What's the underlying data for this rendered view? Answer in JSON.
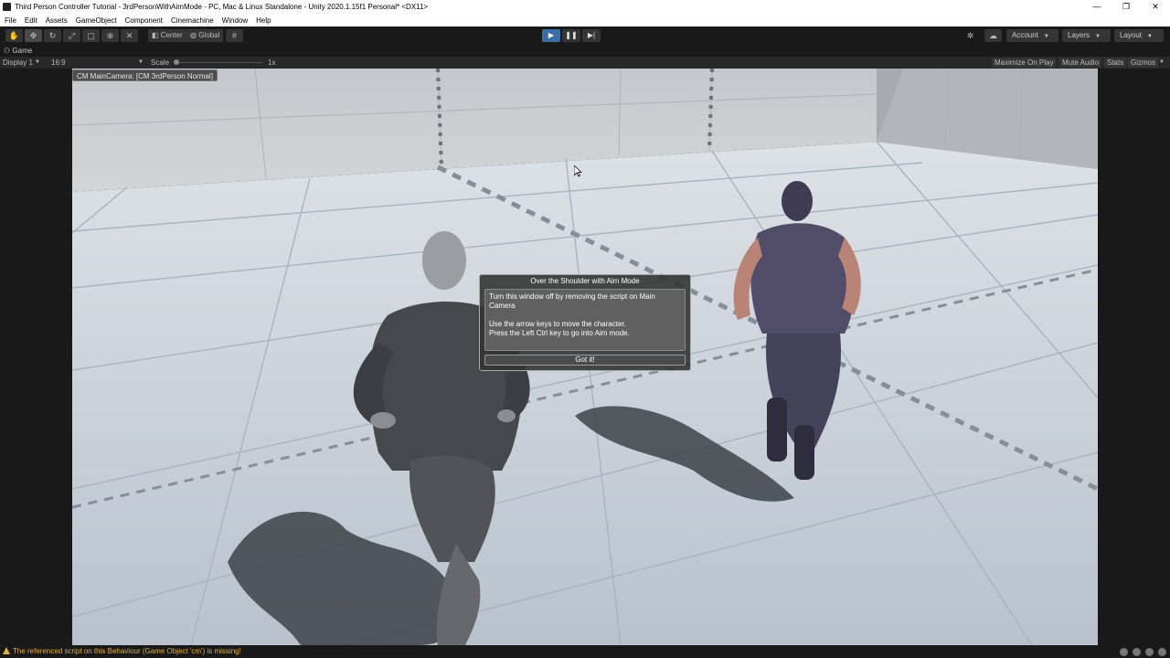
{
  "window": {
    "title": "Third Person Controller Tutorial - 3rdPersonWithAimMode - PC, Mac & Linux Standalone - Unity 2020.1.15f1 Personal* <DX11>",
    "controls": [
      "—",
      "❐",
      "✕"
    ]
  },
  "menu": [
    "File",
    "Edit",
    "Assets",
    "GameObject",
    "Component",
    "Cinemachine",
    "Window",
    "Help"
  ],
  "toolbar": {
    "tools": [
      "hand-tool",
      "move-tool",
      "rotate-tool",
      "scale-tool",
      "rect-tool",
      "transform-tool",
      "custom-tool"
    ],
    "pivot_label": "Center",
    "space_label": "Global",
    "account_label": "Account",
    "layers_label": "Layers",
    "layout_label": "Layout"
  },
  "tab": {
    "label": "Game"
  },
  "gamebar": {
    "display": "Display 1",
    "aspect": "16:9",
    "scale_label": "Scale",
    "scale_value": "1x",
    "maximize": "Maximize On Play",
    "mute": "Mute Audio",
    "stats": "Stats",
    "gizmos": "Gizmos"
  },
  "viewport": {
    "camera_label": "CM MainCamera: [CM 3rdPerson Normal]"
  },
  "dialog": {
    "title": "Over the Shoulder with Aim Mode",
    "line1": "Turn this window off by removing the script on Main Camera",
    "line2": "Use the arrow keys to move the character.",
    "line3": "Press the Left Ctrl key to go into Aim mode.",
    "button": "Got it!"
  },
  "status": {
    "message": "The referenced script on this Behaviour (Game Object 'cm') is missing!"
  },
  "colors": {
    "editor_bg": "#191919",
    "play_active": "#3b6fa8",
    "warning": "#e0b040",
    "floor": "#c4ccd6",
    "wall": "#c9cdd1"
  }
}
